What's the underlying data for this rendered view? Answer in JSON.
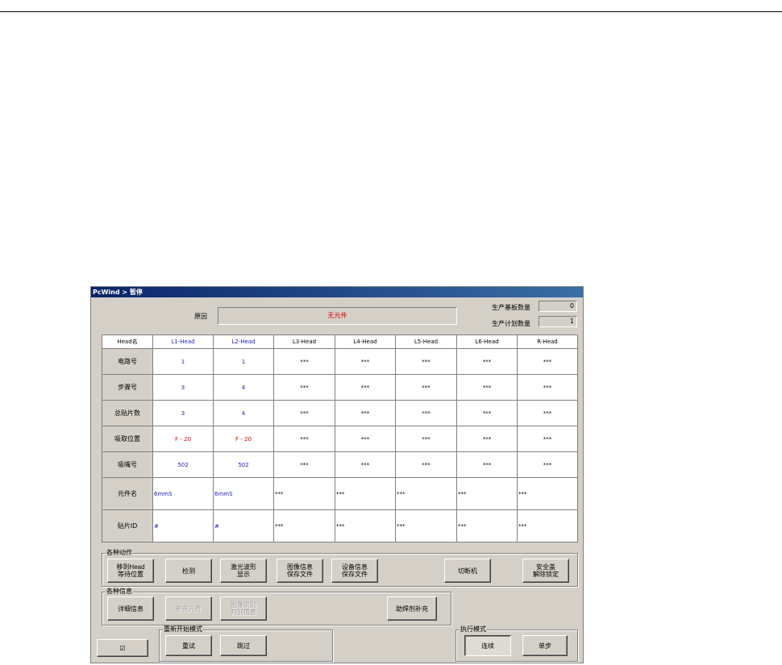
{
  "window": {
    "title": "PcWind > 暂停"
  },
  "reason": {
    "label": "原因",
    "value": "无元件"
  },
  "production": {
    "base_label": "生产基板数量",
    "base_value": "0",
    "plan_label": "生产计划数量",
    "plan_value": "1"
  },
  "grid": {
    "corner": "Head名",
    "columns": [
      "L1-Head",
      "L2-Head",
      "L3-Head",
      "L4-Head",
      "L5-Head",
      "L6-Head",
      "R-Head"
    ],
    "rows": [
      {
        "label": "电路号",
        "cells": [
          "1",
          "1",
          "***",
          "***",
          "***",
          "***",
          "***"
        ]
      },
      {
        "label": "步骤号",
        "cells": [
          "3",
          "4",
          "***",
          "***",
          "***",
          "***",
          "***"
        ]
      },
      {
        "label": "总贴片数",
        "cells": [
          "3",
          "4",
          "***",
          "***",
          "***",
          "***",
          "***"
        ]
      },
      {
        "label": "吸取位置",
        "cells": [
          "F - 20",
          "F - 20",
          "***",
          "***",
          "***",
          "***",
          "***"
        ]
      },
      {
        "label": "吸嘴号",
        "cells": [
          "502",
          "502",
          "***",
          "***",
          "***",
          "***",
          "***"
        ]
      },
      {
        "label": "元件名",
        "cells": [
          "6mmS",
          "6mmS",
          "***",
          "***",
          "***",
          "***",
          "***"
        ]
      },
      {
        "label": "贴片ID",
        "cells": [
          "#",
          "#",
          "***",
          "***",
          "***",
          "***",
          "***"
        ]
      }
    ]
  },
  "actions": {
    "title": "各种动作",
    "move_head": "移到Head\n等待位置",
    "inspect": "检测",
    "laser": "激光波形\n显示",
    "image_info": "图像信息\n保存文件",
    "device_info": "设备信息\n保存文件",
    "cut": "切断机",
    "safety": "安全盖\n解除锁定"
  },
  "info": {
    "title": "各种信息",
    "detail": "详细信息",
    "add_part": "补充元件",
    "image_recog": "图像识别\n判别信息",
    "solder_add": "助焊剂补充"
  },
  "restart": {
    "title": "重新开始模式",
    "retry": "重试",
    "skip": "跳过"
  },
  "exec": {
    "title": "执行模式",
    "continuous": "连续",
    "step": "单步"
  },
  "checkbox_glyph": "☑"
}
